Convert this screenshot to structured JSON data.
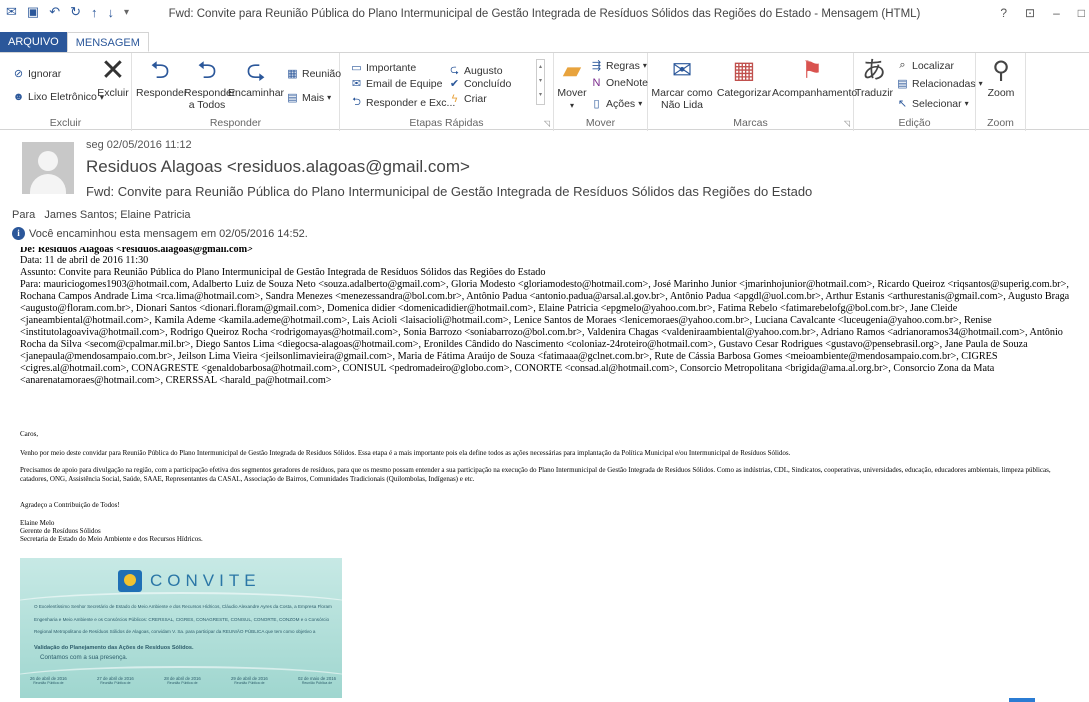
{
  "window": {
    "title": "Fwd: Convite para Reunião Pública do Plano Intermunicipal de Gestão Integrada de Resíduos Sólidos das Regiões do Estado - Mensagem (HTML)",
    "controls": [
      "?",
      "⊡",
      "–",
      "□"
    ]
  },
  "tabs": {
    "file": "ARQUIVO",
    "message": "MENSAGEM"
  },
  "ribbon": {
    "excluir": {
      "ignore": "Ignorar",
      "junk": "Lixo Eletrônico",
      "delete": "Excluir",
      "label": "Excluir"
    },
    "responder": {
      "reply": "Responder",
      "reply_all": "Responder a Todos",
      "forward": "Encaminhar",
      "meeting": "Reunião",
      "more": "Mais",
      "label": "Responder"
    },
    "quick_steps": {
      "items": [
        "Importante",
        "Email de Equipe",
        "Responder e Exc...",
        "Augusto",
        "Concluído",
        "Criar"
      ],
      "label": "Etapas Rápidas"
    },
    "move": {
      "move": "Mover",
      "rules": "Regras",
      "onenote": "OneNote",
      "actions": "Ações",
      "label": "Mover"
    },
    "tags": {
      "mark_unread": "Marcar como Não Lida",
      "categorize": "Categorizar",
      "follow_up": "Acompanhamento",
      "label": "Marcas"
    },
    "editing": {
      "translate": "Traduzir",
      "find": "Localizar",
      "related": "Relacionadas",
      "select": "Selecionar",
      "label": "Edição"
    },
    "zoom": {
      "zoom": "Zoom",
      "label": "Zoom"
    }
  },
  "message": {
    "date": "seg 02/05/2016 11:12",
    "from": "Residuos Alagoas <residuos.alagoas@gmail.com>",
    "subject": "Fwd: Convite para Reunião Pública do Plano Intermunicipal de Gestão Integrada de Resíduos Sólidos das Regiões do Estado",
    "to_label": "Para",
    "to": "James Santos; Elaine Patricia",
    "info": "Você encaminhou esta mensagem em 02/05/2016 14:52."
  },
  "forwarded": {
    "de": "De: Residuos Alagoas <residuos.alagoas@gmail.com>",
    "data": "Data: 11 de abril de 2016 11:30",
    "assunto": "Assunto: Convite para Reunião Pública do Plano Intermunicipal de Gestão Integrada de Resíduos Sólidos das Regiões do Estado",
    "para": "Para: mauriciogomes1903@hotmail.com, Adalberto Luiz de Souza Neto <souza.adalberto@gmail.com>, Gloria Modesto <gloriamodesto@hotmail.com>, José Marinho Junior <jmarinhojunior@hotmail.com>, Ricardo Queiroz <riqsantos@superig.com.br>, Rochana Campos Andrade Lima <rca.lima@hotmail.com>, Sandra Menezes <menezessandra@bol.com.br>, Antônio Padua <antonio.padua@arsal.al.gov.br>, Antônio Padua <apgdl@uol.com.br>, Arthur Estanis <arthurestanis@gmail.com>, Augusto Braga <augusto@floram.com.br>, Dionari Santos <dionari.floram@gmail.com>, Domenica didier <domenicadidier@hotmail.com>, Elaine Patricia <epgmelo@yahoo.com.br>, Fatima Rebelo <fatimarebelofg@bol.com.br>, Jane Cleide <janeambiental@hotmail.com>, Kamila Ademe <kamila.ademe@hotmail.com>, Lais Acioli <laisacioli@hotmail.com>, Lenice Santos de Moraes <lenicemoraes@yahoo.com.br>, Luciana Cavalcante <luceugenia@yahoo.com.br>, Renise <institutolagoaviva@hotmail.com>, Rodrigo Queiroz Rocha <rodrigomayas@hotmail.com>, Sonia Barrozo <soniabarrozo@bol.com.br>, Valdenira Chagas <valdeniraambiental@yahoo.com.br>, Adriano Ramos <adrianoramos34@hotmail.com>, Antônio Rocha da Silva <secom@cpalmar.mil.br>, Diego Santos Lima <diegocsa-alagoas@hotmail.com>, Eronildes Cândido do Nascimento <coloniaz-24roteiro@hotmail.com>, Gustavo Cesar Rodrigues <gustavo@pensebrasil.org>, Jane Paula de Souza <janepaula@mendosampaio.com.br>, Jeilson Lima Vieira <jeilsonlimavieira@gmail.com>, Maria de Fátima Araújo de Souza <fatimaaa@gclnet.com.br>, Rute de Cássia Barbosa Gomes <meioambiente@mendosampaio.com.br>, CIGRES <cigres.al@hotmail.com>, CONAGRESTE <genaldobarbosa@hotmail.com>, CONISUL <pedromadeiro@globo.com>, CONORTE <consad.al@hotmail.com>, Consorcio Metropolitana <brigida@ama.al.org.br>, Consorcio Zona da Mata <anarenatamoraes@hotmail.com>, CRERSSAL <harald_pa@hotmail.com>"
  },
  "body": {
    "greeting": "Caros,",
    "p1": "Venho por meio deste convidar para Reunião Pública do Plano Intermunicipal de Gestão Integrada de Resíduos Sólidos. Essa etapa é a mais importante pois ela define todos as ações necessárias para implantação da Política Municipal e/ou Intermunicipal de Resíduos Sólidos.",
    "p2": "Precisamos de apoio para divulgação na região, com a participação efetiva dos segmentos geradores de resíduos, para que os mesmo possam entender a sua participação na execução do Plano Intermunicipal de Gestão Integrada de Resíduos Sólidos. Como as indústrias, CDL, Sindicatos, cooperativas, universidades, educação, educadores ambientais, limpeza públicas, catadores, ONG, Assistência Social, Saúde, SAAE, Representantes da CASAL, Associação de Bairros, Comunidades Tradicionais (Quilombolas, Indígenas) e etc.",
    "thanks": "Agradeço a Contribuição de Todos!",
    "sig_name": "Elaine Melo",
    "sig_role": "Gerente de Resíduos Sólidos",
    "sig_org": "Secretaria de Estado do Meio Ambiente e dos Recursos Hídricos."
  },
  "invite": {
    "word": "CONVITE",
    "line1": "O Excelentíssimo Senhor Secretário de Estado do Meio Ambiente e dos Recursos Hídricos, Cláudio Alexandre Ayres da Costa, a Empresa Floram",
    "line2": "Engenharia e Meio Ambiente e os Consórcios Públicos: CRERSSAL, CIGRES, CONAGRESTE, CONISUL, CONORTE, CONZOM e o Consórcio",
    "line3": "Regional Metropolitano de Resíduos Sólidos de Alagoas, convidam V. Sa. para participar da REUNIÃO PÚBLICA que tem como objetivo a",
    "validation": "Validação do Planejamento das Ações de Resíduos Sólidos.",
    "count": "Contamos com a sua presença.",
    "dates": [
      {
        "date": "26 de abril de 2016",
        "place": "Reunião Pública de"
      },
      {
        "date": "27 de abril de 2016",
        "place": "Reunião Pública de"
      },
      {
        "date": "28 de abril de 2016",
        "place": "Reunião Pública de"
      },
      {
        "date": "29 de abril de 2016",
        "place": "Reunião Pública de"
      },
      {
        "date": "02 de maio de 2016",
        "place": "Reunião Pública de"
      }
    ]
  }
}
